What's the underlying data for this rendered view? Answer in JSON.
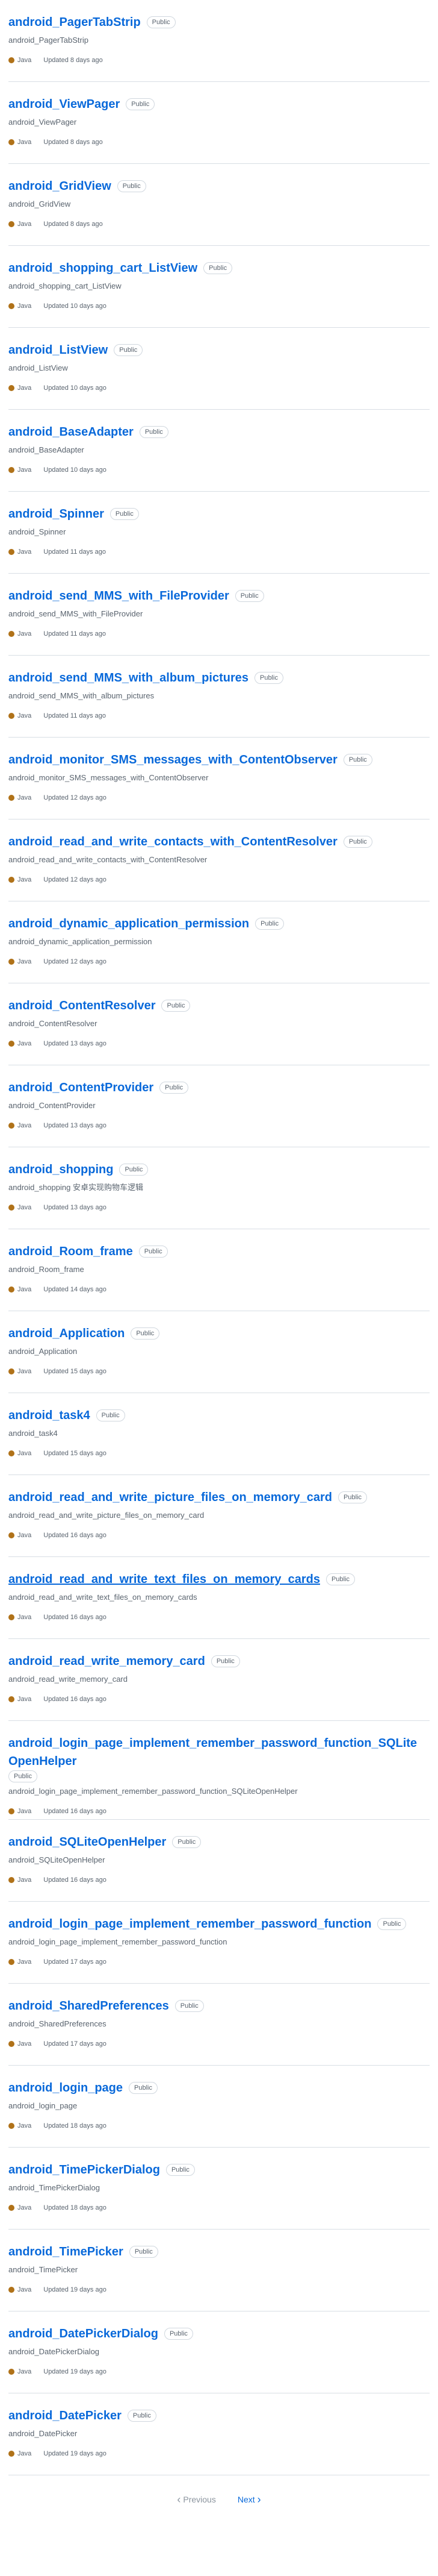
{
  "visibility_label": "Public",
  "language_color": "#b07219",
  "repos": [
    {
      "name": "android_PagerTabStrip",
      "description": "android_PagerTabStrip",
      "language": "Java",
      "updated": "Updated 8 days ago"
    },
    {
      "name": "android_ViewPager",
      "description": "android_ViewPager",
      "language": "Java",
      "updated": "Updated 8 days ago"
    },
    {
      "name": "android_GridView",
      "description": "android_GridView",
      "language": "Java",
      "updated": "Updated 8 days ago"
    },
    {
      "name": "android_shopping_cart_ListView",
      "description": "android_shopping_cart_ListView",
      "language": "Java",
      "updated": "Updated 10 days ago"
    },
    {
      "name": "android_ListView",
      "description": "android_ListView",
      "language": "Java",
      "updated": "Updated 10 days ago"
    },
    {
      "name": "android_BaseAdapter",
      "description": "android_BaseAdapter",
      "language": "Java",
      "updated": "Updated 10 days ago"
    },
    {
      "name": "android_Spinner",
      "description": "android_Spinner",
      "language": "Java",
      "updated": "Updated 11 days ago"
    },
    {
      "name": "android_send_MMS_with_FileProvider",
      "description": "android_send_MMS_with_FileProvider",
      "language": "Java",
      "updated": "Updated 11 days ago"
    },
    {
      "name": "android_send_MMS_with_album_pictures",
      "description": "android_send_MMS_with_album_pictures",
      "language": "Java",
      "updated": "Updated 11 days ago"
    },
    {
      "name": "android_monitor_SMS_messages_with_ContentObserver",
      "description": "android_monitor_SMS_messages_with_ContentObserver",
      "language": "Java",
      "updated": "Updated 12 days ago"
    },
    {
      "name": "android_read_and_write_contacts_with_ContentResolver",
      "description": "android_read_and_write_contacts_with_ContentResolver",
      "language": "Java",
      "updated": "Updated 12 days ago"
    },
    {
      "name": "android_dynamic_application_permission",
      "description": "android_dynamic_application_permission",
      "language": "Java",
      "updated": "Updated 12 days ago"
    },
    {
      "name": "android_ContentResolver",
      "description": "android_ContentResolver",
      "language": "Java",
      "updated": "Updated 13 days ago"
    },
    {
      "name": "android_ContentProvider",
      "description": "android_ContentProvider",
      "language": "Java",
      "updated": "Updated 13 days ago"
    },
    {
      "name": "android_shopping",
      "description": "android_shopping 安卓实现购物车逻辑",
      "language": "Java",
      "updated": "Updated 13 days ago"
    },
    {
      "name": "android_Room_frame",
      "description": "android_Room_frame",
      "language": "Java",
      "updated": "Updated 14 days ago"
    },
    {
      "name": "android_Application",
      "description": "android_Application",
      "language": "Java",
      "updated": "Updated 15 days ago"
    },
    {
      "name": "android_task4",
      "description": "android_task4",
      "language": "Java",
      "updated": "Updated 15 days ago"
    },
    {
      "name": "android_read_and_write_picture_files_on_memory_card",
      "description": "android_read_and_write_picture_files_on_memory_card",
      "language": "Java",
      "updated": "Updated 16 days ago"
    },
    {
      "name": "android_read_and_write_text_files_on_memory_cards",
      "description": "android_read_and_write_text_files_on_memory_cards",
      "language": "Java",
      "updated": "Updated 16 days ago"
    },
    {
      "name": "android_read_write_memory_card",
      "description": "android_read_write_memory_card",
      "language": "Java",
      "updated": "Updated 16 days ago"
    },
    {
      "name": "android_login_page_implement_remember_password_function_SQLiteOpenHelper",
      "description": "android_login_page_implement_remember_password_function_SQLiteOpenHelper",
      "language": "Java",
      "updated": "Updated 16 days ago"
    },
    {
      "name": "android_SQLiteOpenHelper",
      "description": "android_SQLiteOpenHelper",
      "language": "Java",
      "updated": "Updated 16 days ago"
    },
    {
      "name": "android_login_page_implement_remember_password_function",
      "description": "android_login_page_implement_remember_password_function",
      "language": "Java",
      "updated": "Updated 17 days ago"
    },
    {
      "name": "android_SharedPreferences",
      "description": "android_SharedPreferences",
      "language": "Java",
      "updated": "Updated 17 days ago"
    },
    {
      "name": "android_login_page",
      "description": "android_login_page",
      "language": "Java",
      "updated": "Updated 18 days ago"
    },
    {
      "name": "android_TimePickerDialog",
      "description": "android_TimePickerDialog",
      "language": "Java",
      "updated": "Updated 18 days ago"
    },
    {
      "name": "android_TimePicker",
      "description": "android_TimePicker",
      "language": "Java",
      "updated": "Updated 19 days ago"
    },
    {
      "name": "android_DatePickerDialog",
      "description": "android_DatePickerDialog",
      "language": "Java",
      "updated": "Updated 19 days ago"
    },
    {
      "name": "android_DatePicker",
      "description": "android_DatePicker",
      "language": "Java",
      "updated": "Updated 19 days ago"
    }
  ],
  "pagination": {
    "previous_label": "Previous",
    "next_label": "Next"
  }
}
